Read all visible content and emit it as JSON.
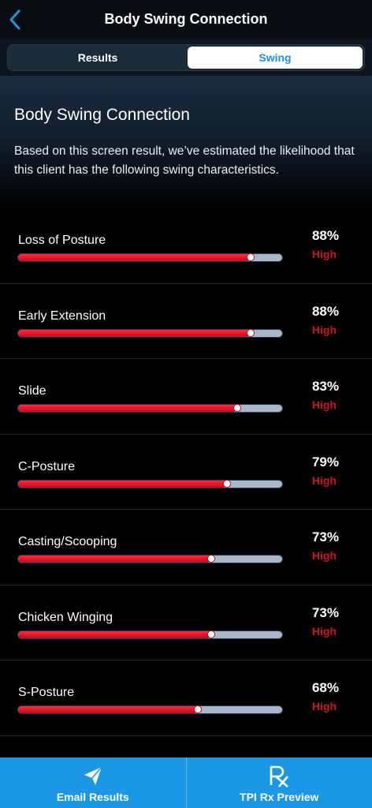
{
  "header": {
    "title": "Body Swing Connection"
  },
  "tabs": {
    "results": "Results",
    "swing": "Swing"
  },
  "intro": {
    "title": "Body Swing Connection",
    "text": "Based on this screen result, we’ve estimated the likelihood that this client has the following swing characteristics."
  },
  "characteristics": [
    {
      "label": "Loss of Posture",
      "percent_text": "88%",
      "value": 0.88,
      "level": "High"
    },
    {
      "label": "Early Extension",
      "percent_text": "88%",
      "value": 0.88,
      "level": "High"
    },
    {
      "label": "Slide",
      "percent_text": "83%",
      "value": 0.83,
      "level": "High"
    },
    {
      "label": "C-Posture",
      "percent_text": "79%",
      "value": 0.79,
      "level": "High"
    },
    {
      "label": "Casting/Scooping",
      "percent_text": "73%",
      "value": 0.73,
      "level": "High"
    },
    {
      "label": "Chicken Winging",
      "percent_text": "73%",
      "value": 0.73,
      "level": "High"
    },
    {
      "label": "S-Posture",
      "percent_text": "68%",
      "value": 0.68,
      "level": "High"
    }
  ],
  "bottom": {
    "email": "Email Results",
    "rx": "TPI Rx Preview"
  },
  "colors": {
    "accent": "#1a98e6",
    "high": "#d0141e",
    "bar_fill": "#e3101f",
    "track": "#a9b7c6"
  },
  "icons": {
    "back": "chevron-left-icon",
    "email": "send-icon",
    "rx": "rx-icon"
  }
}
